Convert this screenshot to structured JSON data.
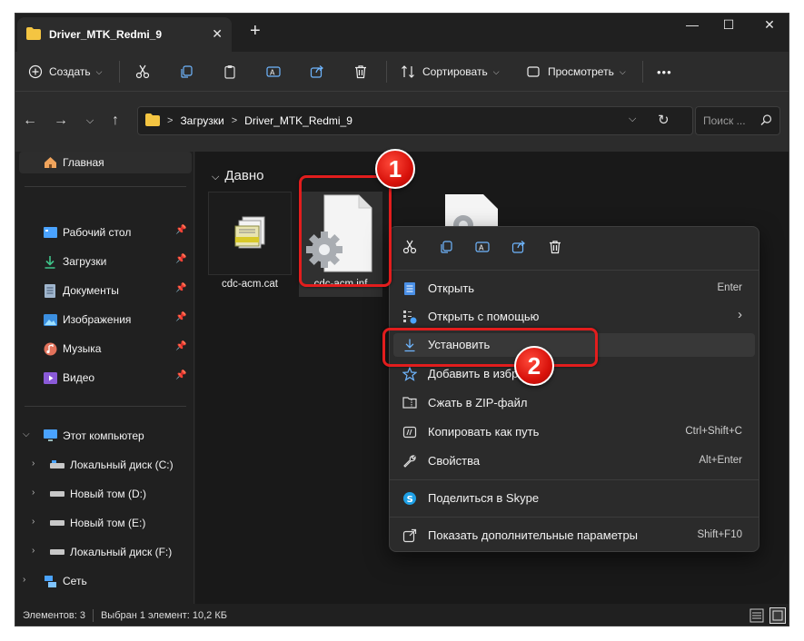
{
  "window": {
    "tab_title": "Driver_MTK_Redmi_9",
    "tab_close": "✕",
    "new_tab": "+",
    "minimize": "—",
    "maximize": "☐",
    "close": "✕"
  },
  "toolbar": {
    "create_label": "Создать",
    "sort_label": "Сортировать",
    "view_label": "Просмотреть",
    "more_label": "•••"
  },
  "address": {
    "crumbs": [
      "Загрузки",
      "Driver_MTK_Redmi_9"
    ],
    "separator": ">",
    "search_placeholder": "Поиск ..."
  },
  "sidebar": {
    "home": "Главная",
    "pinned": [
      {
        "label": "Рабочий стол",
        "icon": "desktop-icon"
      },
      {
        "label": "Загрузки",
        "icon": "download-icon"
      },
      {
        "label": "Документы",
        "icon": "document-icon"
      },
      {
        "label": "Изображения",
        "icon": "image-icon"
      },
      {
        "label": "Музыка",
        "icon": "music-icon"
      },
      {
        "label": "Видео",
        "icon": "video-icon"
      }
    ],
    "this_pc": "Этот компьютер",
    "drives": [
      "Локальный диск (C:)",
      "Новый том (D:)",
      "Новый том (E:)",
      "Локальный диск (F:)"
    ],
    "network": "Сеть"
  },
  "content": {
    "group": "Давно",
    "files": [
      {
        "name": "cdc-acm.cat"
      },
      {
        "name": "cdc-acm.inf"
      },
      {
        "name": ""
      }
    ]
  },
  "status": {
    "count": "Элементов: 3",
    "selection": "Выбран 1 элемент: 10,2 КБ"
  },
  "context_menu": {
    "items": [
      {
        "label": "Открыть",
        "shortcut": "Enter"
      },
      {
        "label": "Открыть с помощью",
        "shortcut": "›"
      },
      {
        "label": "Установить",
        "shortcut": ""
      },
      {
        "label": "Добавить в избранное",
        "shortcut": ""
      },
      {
        "label": "Сжать в ZIP-файл",
        "shortcut": ""
      },
      {
        "label": "Копировать как путь",
        "shortcut": "Ctrl+Shift+C"
      },
      {
        "label": "Свойства",
        "shortcut": "Alt+Enter"
      },
      {
        "label": "Поделиться в Skype",
        "shortcut": ""
      },
      {
        "label": "Показать дополнительные параметры",
        "shortcut": "Shift+F10"
      }
    ]
  },
  "annotations": {
    "step1": "1",
    "step2": "2"
  },
  "colors": {
    "highlight": "#e21d1d",
    "accent": "#4aa3ff",
    "folder": "#f4c542"
  }
}
